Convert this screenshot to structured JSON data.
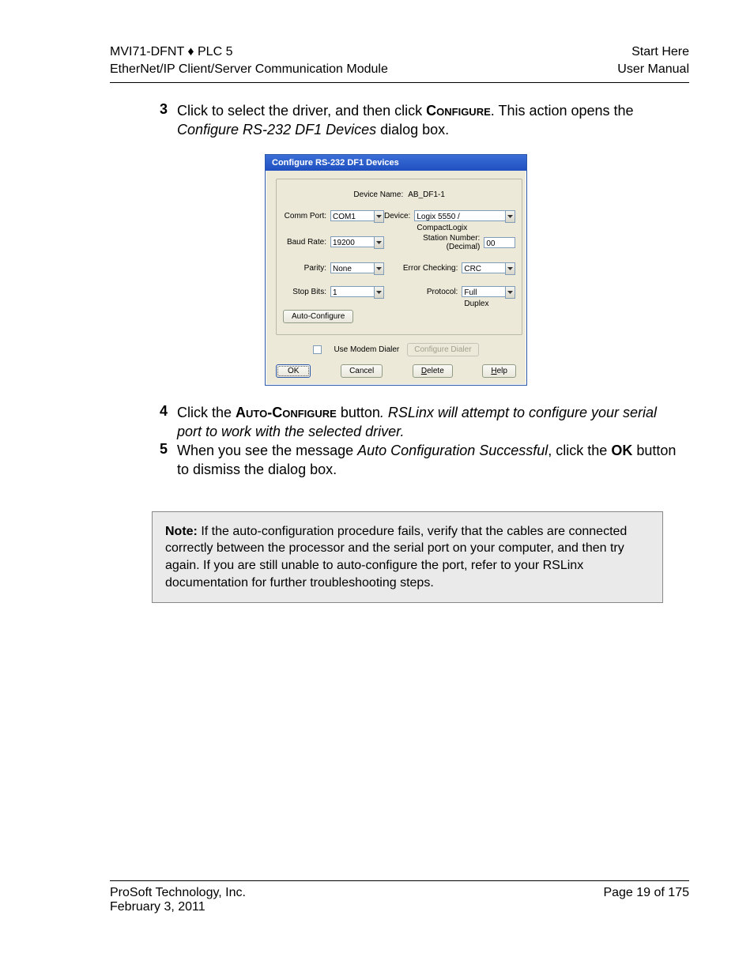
{
  "header": {
    "left_line1": "MVI71-DFNT ♦ PLC 5",
    "left_line2": "EtherNet/IP Client/Server Communication Module",
    "right_line1": "Start Here",
    "right_line2": "User Manual"
  },
  "step3": {
    "num": "3",
    "pre": "Click to select the driver, and then click ",
    "smallcaps": "Configure",
    "post1": ". This action opens the ",
    "italic": "Configure RS-232 DF1 Devices",
    "post2": " dialog box."
  },
  "dialog": {
    "title": "Configure RS-232 DF1 Devices",
    "device_name_label": "Device Name:",
    "device_name_value": "AB_DF1-1",
    "comm_port_label": "Comm Port:",
    "comm_port_value": "COM1",
    "device_label": "Device:",
    "device_value": "Logix 5550 / CompactLogix",
    "baud_label": "Baud Rate:",
    "baud_value": "19200",
    "station_label_1": "Station Number:",
    "station_label_2": "(Decimal)",
    "station_value": "00",
    "parity_label": "Parity:",
    "parity_value": "None",
    "error_label": "Error Checking:",
    "error_value": "CRC",
    "stopbits_label": "Stop Bits:",
    "stopbits_value": "1",
    "protocol_label": "Protocol:",
    "protocol_value": "Full Duplex",
    "auto_configure_btn": "Auto-Configure",
    "use_modem_label": "Use Modem Dialer",
    "configure_dialer_btn": "Configure Dialer",
    "ok_btn": "OK",
    "cancel_btn": "Cancel",
    "delete_pre": "D",
    "delete_post": "elete",
    "help_pre": "H",
    "help_post": "elp"
  },
  "step4": {
    "num": "4",
    "pre": "Click the ",
    "smallcaps": "Auto-Configure",
    "post1": " button",
    "post2": ". RSLinx will attempt to configure your serial port to work with the selected driver."
  },
  "step5": {
    "num": "5",
    "pre": "When you see the message ",
    "italic": "Auto Configuration Successful",
    "mid": ", click the ",
    "bold": "OK",
    "post": " button to dismiss the dialog box."
  },
  "note": {
    "label": "Note:",
    "text": " If the auto-configuration procedure fails, verify that the cables are connected correctly between the processor and the serial port on your computer, and then try again. If you are still unable to auto-configure the port, refer to your RSLinx documentation for further troubleshooting steps."
  },
  "footer": {
    "company": "ProSoft Technology, Inc.",
    "date": "February 3, 2011",
    "page": "Page 19 of 175"
  }
}
